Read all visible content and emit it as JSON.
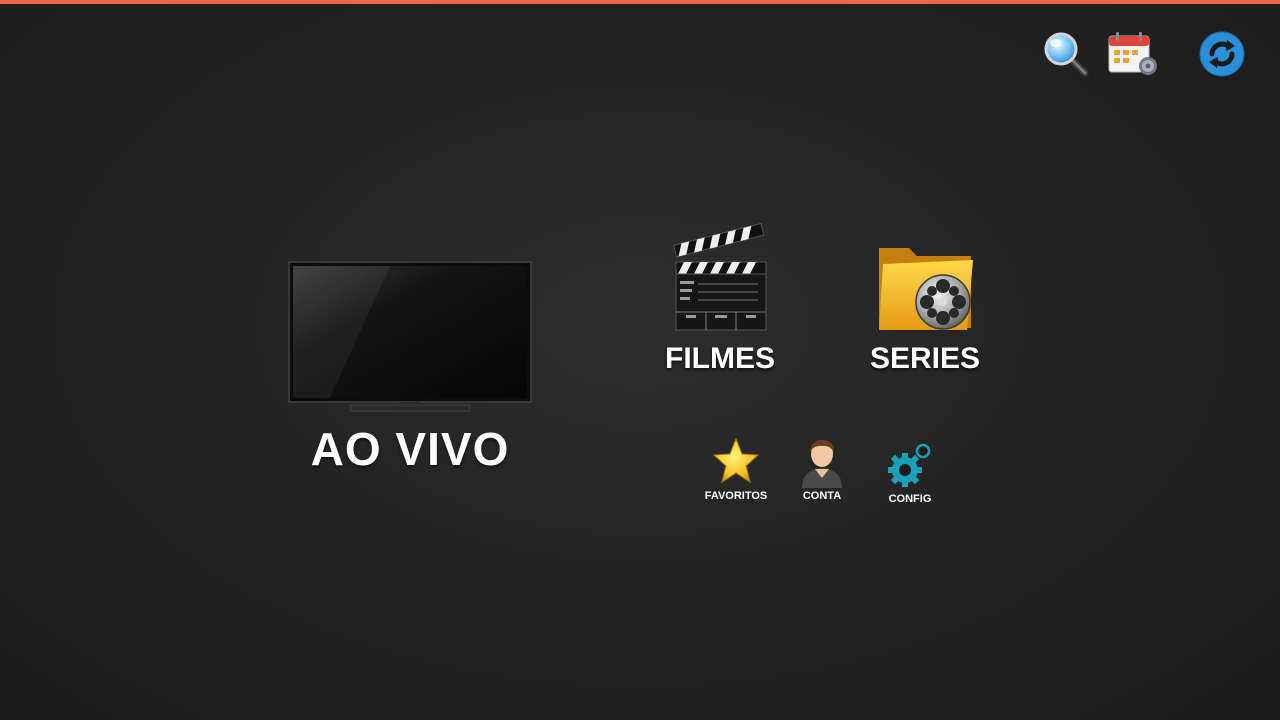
{
  "colors": {
    "top_accent": "#e8694a",
    "refresh_icon": "#2a8fd6",
    "search_icon": "#3aa0e6",
    "config_icon": "#1aa0b8",
    "star_icon": "#f3c221"
  },
  "toolbar": {
    "search_icon": "search-icon",
    "epg_icon": "calendar-gear-icon",
    "refresh_icon": "refresh-icon"
  },
  "main": {
    "live_label": "AO VIVO",
    "movies_label": "FILMES",
    "series_label": "SERIES"
  },
  "secondary": {
    "favorites_label": "FAVORITOS",
    "account_label": "CONTA",
    "config_label": "CONFIG"
  }
}
